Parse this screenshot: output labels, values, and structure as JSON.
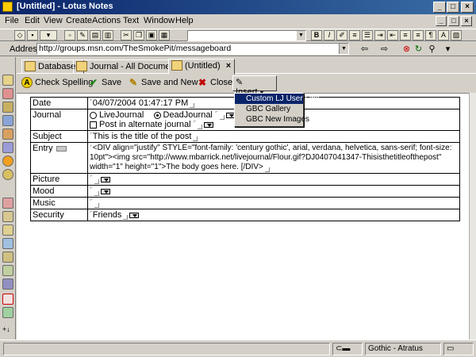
{
  "window": {
    "title": "[Untitled] - Lotus Notes"
  },
  "menu": [
    "File",
    "Edit",
    "View",
    "Create",
    "Actions",
    "Text",
    "Window",
    "Help"
  ],
  "address": {
    "label": "Address",
    "url": "http://groups.msn.com/TheSmokePit/messageboard"
  },
  "tabs": [
    {
      "label": "Databases",
      "icon": "databases-icon"
    },
    {
      "label": "Journal - All Documents",
      "icon": "journal-icon"
    },
    {
      "label": "(Untitled)",
      "icon": "document-icon"
    }
  ],
  "actions": {
    "check_spelling": "Check Spelling",
    "save": "Save",
    "save_and_new": "Save and New",
    "close": "Close",
    "insert": "Insert"
  },
  "insert_menu": [
    "Custom LJ User Link",
    "GBC Gallery",
    "GBC New Images"
  ],
  "form": {
    "date_label": "Date",
    "date_value": "04/07/2004 01:47:17 PM",
    "journal_label": "Journal",
    "journal_options": [
      "LiveJournal",
      "DeadJournal"
    ],
    "journal_selected": "DeadJournal",
    "alternate_label": "Post in alternate journal",
    "subject_label": "Subject",
    "subject_value": "This is the title of the post",
    "entry_label": "Entry",
    "entry_value": "<DIV align=\"justify\" STYLE=\"font-family: 'century gothic', arial, verdana, helvetica, sans-serif; font-size: 10pt\"><img src=\"http://www.mbarrick.net/livejournal/Flour.gif?DJ0407041347-Thisisthetitleofthepost\" width=\"1\" height=\"1\">The body goes here. [/DIV>",
    "picture_label": "Picture",
    "mood_label": "Mood",
    "music_label": "Music",
    "security_label": "Security",
    "security_value": "Friends"
  },
  "status": {
    "font": "Gothic - Atratus"
  }
}
